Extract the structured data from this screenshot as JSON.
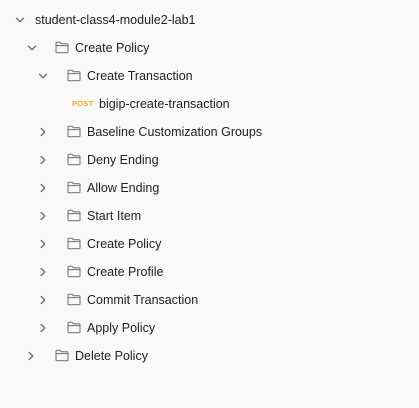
{
  "collection": {
    "name": "student-class4-module2-lab1",
    "expanded": true
  },
  "folders": [
    {
      "name": "Create Policy",
      "expanded": true,
      "children": [
        {
          "name": "Create Transaction",
          "expanded": true,
          "requests": [
            {
              "method": "POST",
              "name": "bigip-create-transaction"
            }
          ]
        },
        {
          "name": "Baseline Customization Groups",
          "expanded": false
        },
        {
          "name": "Deny Ending",
          "expanded": false
        },
        {
          "name": "Allow Ending",
          "expanded": false
        },
        {
          "name": "Start Item",
          "expanded": false
        },
        {
          "name": "Create Policy",
          "expanded": false
        },
        {
          "name": "Create Profile",
          "expanded": false
        },
        {
          "name": "Commit Transaction",
          "expanded": false
        },
        {
          "name": "Apply Policy",
          "expanded": false
        }
      ]
    },
    {
      "name": "Delete Policy",
      "expanded": false
    }
  ],
  "icons": {
    "folder": "folder-icon",
    "chevron_open": "chevron-down-icon",
    "chevron_closed": "chevron-right-icon"
  },
  "colors": {
    "background": "#f9f9f9",
    "text": "#212121",
    "icon": "#6b6b6b",
    "post_method": "#f5a623"
  }
}
